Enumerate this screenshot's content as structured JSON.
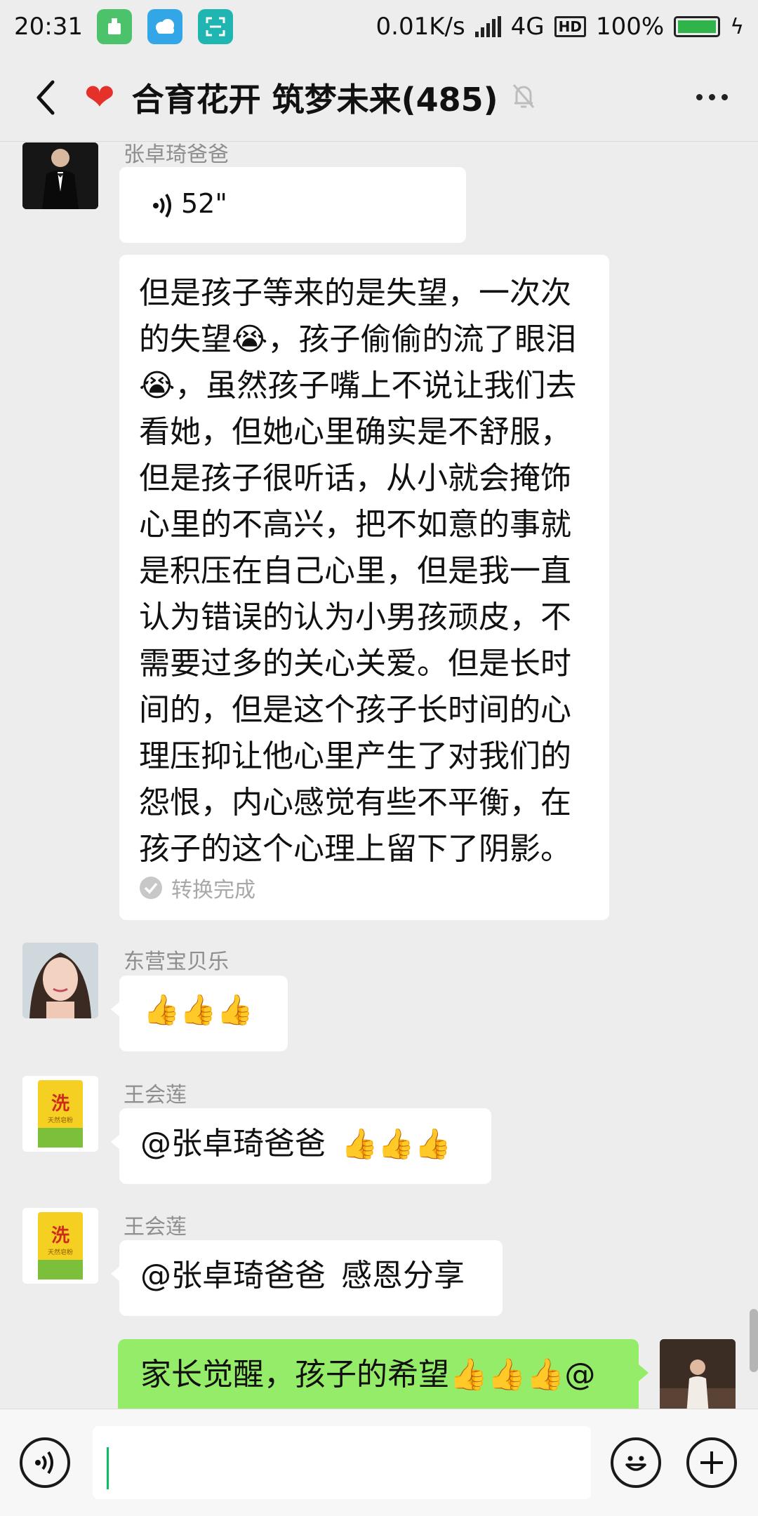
{
  "status": {
    "time": "20:31",
    "speed": "0.01K/s",
    "net": "4G",
    "hd": "HD",
    "battery": "100%"
  },
  "header": {
    "title": "合育花开 筑梦未来(485)"
  },
  "messages": {
    "m1": {
      "sender": "张卓琦爸爸",
      "voice_duration": "52\"",
      "transcript": "但是孩子等来的是失望，一次次的失望😭，孩子偷偷的流了眼泪😭，虽然孩子嘴上不说让我们去看她，但她心里确实是不舒服，但是孩子很听话，从小就会掩饰心里的不高兴，把不如意的事就是积压在自己心里，但是我一直认为错误的认为小男孩顽皮，不需要过多的关心关爱。但是长时间的，但是这个孩子长时间的心理压抑让他心里产生了对我们的怨恨，内心感觉有些不平衡，在孩子的这个心理上留下了阴影。",
      "transcript_status": "转换完成"
    },
    "m2": {
      "sender": "东营宝贝乐",
      "text": "👍👍👍"
    },
    "m3": {
      "sender": "王会莲",
      "mention": "@张卓琦爸爸",
      "text": "👍👍👍"
    },
    "m4": {
      "sender": "王会莲",
      "mention": "@张卓琦爸爸",
      "text": "感恩分享"
    },
    "m5": {
      "text": "家长觉醒，孩子的希望👍👍👍@"
    }
  },
  "avatar_texts": {
    "rice_brand": "洗",
    "rice_sub": "天然皂粉"
  },
  "colors": {
    "accent": "#07c160",
    "bubble_self": "#95ec69",
    "bubble_other": "#ffffff",
    "background": "#ededed"
  }
}
